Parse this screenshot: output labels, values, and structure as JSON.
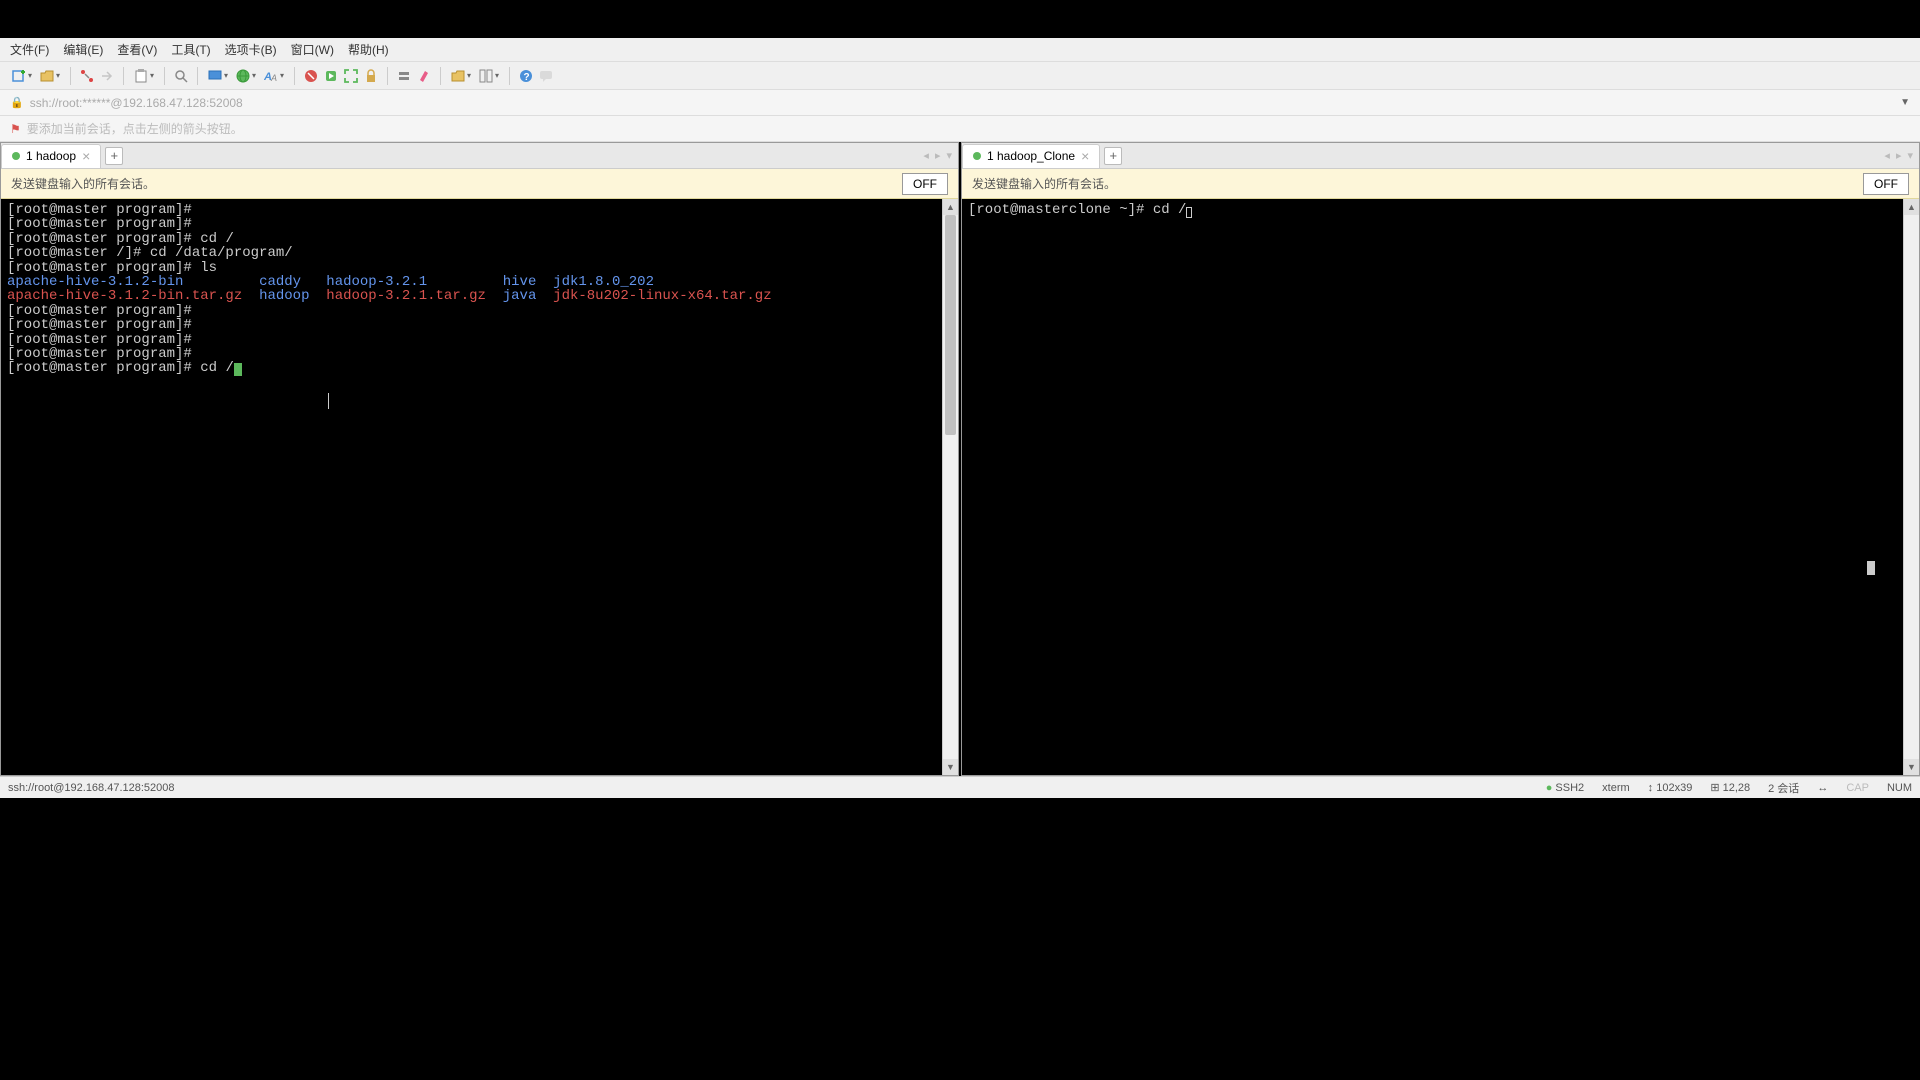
{
  "menu": {
    "file": "文件(F)",
    "edit": "编辑(E)",
    "view": "查看(V)",
    "tools": "工具(T)",
    "options": "选项卡(B)",
    "window": "窗口(W)",
    "help": "帮助(H)"
  },
  "address_bar": {
    "text": "ssh://root:******@192.168.47.128:52008"
  },
  "hint_bar": {
    "text": "要添加当前会话，点击左侧的箭头按钮。"
  },
  "left_pane": {
    "tab_label": "1 hadoop",
    "broadcast_text": "发送键盘输入的所有会话。",
    "broadcast_btn": "OFF",
    "lines": [
      {
        "prompt": "[root@master program]#",
        "cmd": ""
      },
      {
        "prompt": "[root@master program]#",
        "cmd": ""
      },
      {
        "prompt": "[root@master program]#",
        "cmd": " cd /"
      },
      {
        "prompt": "[root@master /]#",
        "cmd": " cd /data/program/"
      },
      {
        "prompt": "[root@master program]#",
        "cmd": " ls"
      }
    ],
    "ls_row1": {
      "c1": "apache-hive-3.1.2-bin",
      "c2": "caddy",
      "c3": "hadoop-3.2.1",
      "c4": "hive",
      "c5": "jdk1.8.0_202"
    },
    "ls_row2": {
      "c1": "apache-hive-3.1.2-bin.tar.gz",
      "c2": "hadoop",
      "c3": "hadoop-3.2.1.tar.gz",
      "c4": "java",
      "c5": "jdk-8u202-linux-x64.tar.gz"
    },
    "tail": [
      "[root@master program]#",
      "[root@master program]#",
      "[root@master program]#",
      "[root@master program]#"
    ],
    "current_prompt": "[root@master program]#",
    "current_cmd": " cd /"
  },
  "right_pane": {
    "tab_label": "1 hadoop_Clone",
    "broadcast_text": "发送键盘输入的所有会话。",
    "broadcast_btn": "OFF",
    "prompt": "[root@masterclone ~]#",
    "cmd": " cd /"
  },
  "status_bar": {
    "left": "ssh://root@192.168.47.128:52008",
    "ssh": "SSH2",
    "term": "xterm",
    "size": "102x39",
    "pos": "12,28",
    "sessions": "2 会话",
    "cap": "CAP",
    "num": "NUM"
  },
  "icons": {
    "new": "new",
    "open": "open",
    "reconnect": "reconnect",
    "forward": "forward",
    "paste": "paste",
    "find": "find",
    "screen": "screen",
    "globe": "globe",
    "font": "font",
    "stop": "stop",
    "go": "go",
    "fullscreen": "fullscreen",
    "lock": "lock",
    "server": "server",
    "highlight": "highlight",
    "folder": "folder",
    "layout": "layout",
    "help": "help",
    "chat": "chat"
  }
}
